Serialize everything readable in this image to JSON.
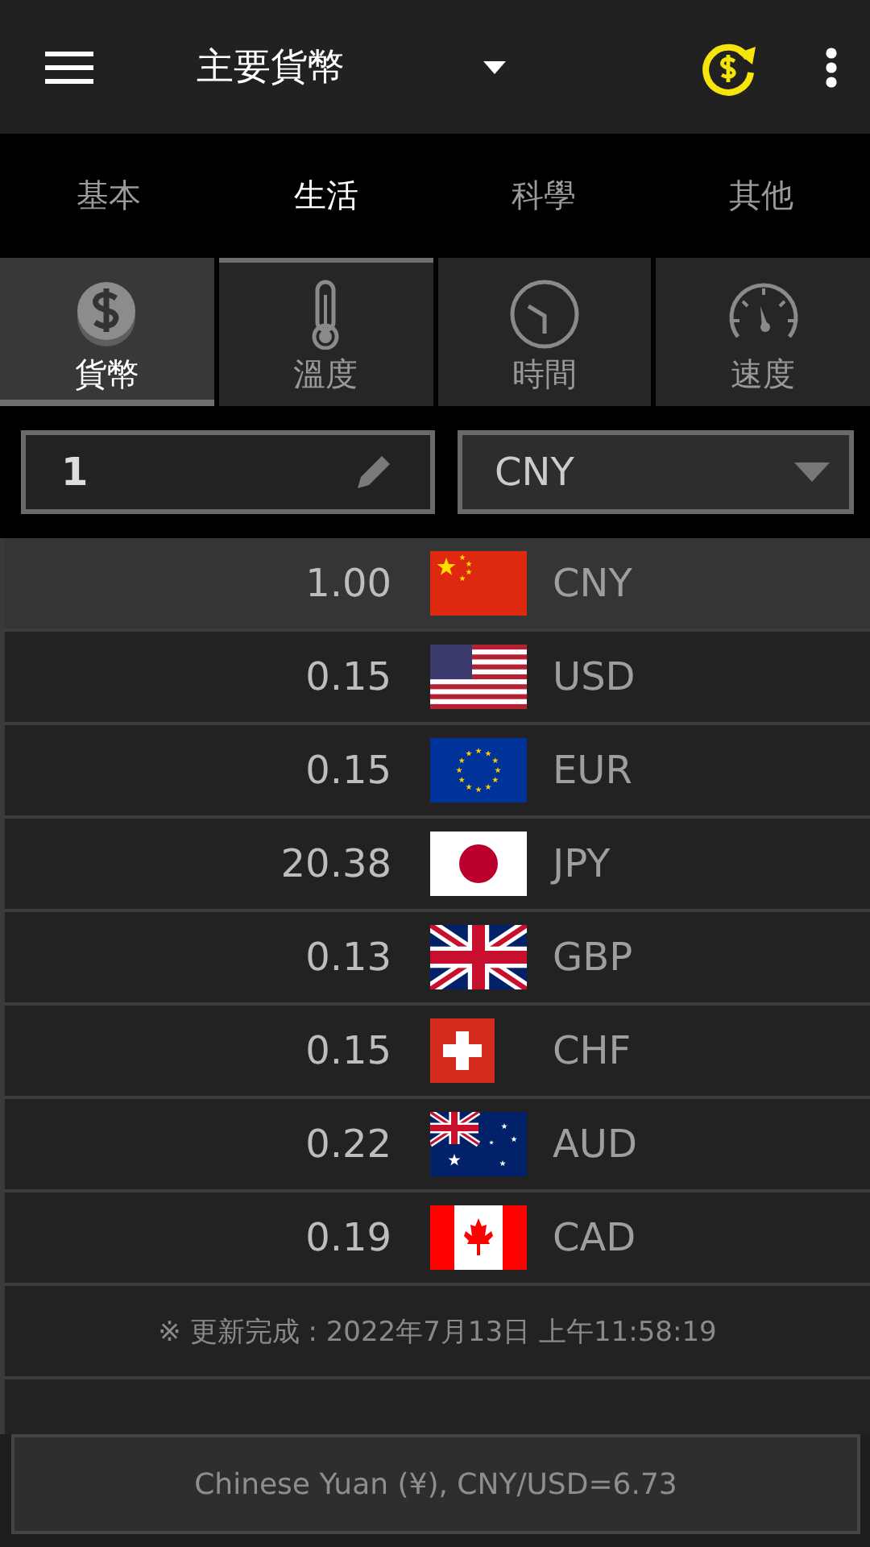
{
  "app_bar": {
    "title": "主要貨幣"
  },
  "tabs": [
    {
      "label": "基本",
      "selected": false
    },
    {
      "label": "生活",
      "selected": true
    },
    {
      "label": "科學",
      "selected": false
    },
    {
      "label": "其他",
      "selected": false
    }
  ],
  "categories": [
    {
      "label": "貨幣",
      "kind": "currency",
      "selected": true
    },
    {
      "label": "溫度",
      "kind": "temperature",
      "selected": false
    },
    {
      "label": "時間",
      "kind": "time",
      "selected": false
    },
    {
      "label": "速度",
      "kind": "speed",
      "selected": false
    }
  ],
  "amount_field": {
    "value": "1"
  },
  "currency_select": {
    "value": "CNY"
  },
  "rates": [
    {
      "amount": "1.00",
      "code": "CNY",
      "kind": "cn",
      "selected": true
    },
    {
      "amount": "0.15",
      "code": "USD",
      "kind": "us",
      "selected": false
    },
    {
      "amount": "0.15",
      "code": "EUR",
      "kind": "eu",
      "selected": false
    },
    {
      "amount": "20.38",
      "code": "JPY",
      "kind": "jp",
      "selected": false
    },
    {
      "amount": "0.13",
      "code": "GBP",
      "kind": "gb",
      "selected": false
    },
    {
      "amount": "0.15",
      "code": "CHF",
      "kind": "ch",
      "selected": false
    },
    {
      "amount": "0.22",
      "code": "AUD",
      "kind": "au",
      "selected": false
    },
    {
      "amount": "0.19",
      "code": "CAD",
      "kind": "ca",
      "selected": false
    }
  ],
  "update_status": "※ 更新完成 : 2022年7月13日 上午11:58:19",
  "footer_button": "Chinese Yuan (¥), CNY/USD=6.73"
}
